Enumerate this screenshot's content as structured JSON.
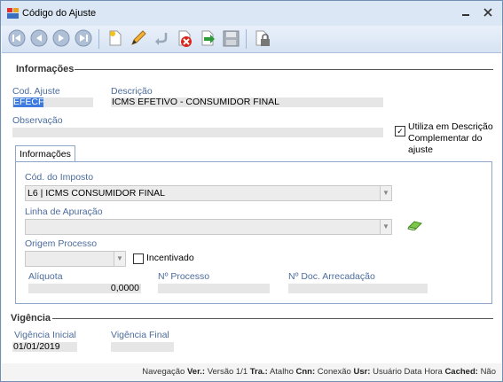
{
  "window": {
    "title": "Código do Ajuste",
    "minimize_icon": "minimize-icon",
    "close_icon": "close-icon"
  },
  "toolbar": {
    "buttons": [
      {
        "name": "first-record-button",
        "icon": "first-icon"
      },
      {
        "name": "previous-record-button",
        "icon": "previous-icon"
      },
      {
        "name": "next-record-button",
        "icon": "next-icon"
      },
      {
        "name": "last-record-button",
        "icon": "last-icon"
      },
      {
        "name": "new-button",
        "icon": "new-document-icon"
      },
      {
        "name": "edit-button",
        "icon": "pencil-icon"
      },
      {
        "name": "undo-button",
        "icon": "undo-icon"
      },
      {
        "name": "delete-button",
        "icon": "delete-icon"
      },
      {
        "name": "confirm-button",
        "icon": "confirm-arrow-icon"
      },
      {
        "name": "save-button",
        "icon": "save-icon"
      },
      {
        "name": "lock-button",
        "icon": "lock-icon"
      }
    ]
  },
  "informacoes": {
    "section_title": "Informações",
    "cod_ajuste": {
      "label": "Cod. Ajuste",
      "value": "EFECF"
    },
    "descricao": {
      "label": "Descrição",
      "value": "ICMS EFETIVO - CONSUMIDOR FINAL"
    },
    "observacao": {
      "label": "Observação",
      "value": ""
    },
    "utiliza_descricao": {
      "label_line1": "Utiliza em Descrição",
      "label_line2": "Complementar do ajuste",
      "checked": true
    }
  },
  "tab": {
    "label": "Informações",
    "cod_imposto": {
      "label": "Cód. do Imposto",
      "value": "L6 | ICMS CONSUMIDOR FINAL"
    },
    "linha_apuracao": {
      "label": "Linha de Apuração",
      "value": ""
    },
    "origem_processo": {
      "label": "Origem Processo",
      "value": ""
    },
    "incentivado": {
      "label": "Incentivado",
      "checked": false
    },
    "aliquota": {
      "label": "Alíquota",
      "value": "0,0000"
    },
    "n_processo": {
      "label": "Nº Processo",
      "value": ""
    },
    "n_doc_arrecadacao": {
      "label": "Nº Doc. Arrecadação",
      "value": ""
    }
  },
  "vigencia": {
    "section_title": "Vigência",
    "inicial": {
      "label": "Vigência Inicial",
      "value": "01/01/2019"
    },
    "final": {
      "label": "Vigência Final",
      "value": ""
    }
  },
  "statusbar": {
    "navegacao": "Navegação",
    "ver_key": "Ver.:",
    "ver_val": "Versão 1/1",
    "tra_key": "Tra.:",
    "tra_val": "Atalho",
    "cnn_key": "Cnn:",
    "cnn_val": "Conexão",
    "usr_key": "Usr:",
    "usr_val": "Usuário Data Hora",
    "cached_key": "Cached:",
    "cached_val": "Não"
  }
}
